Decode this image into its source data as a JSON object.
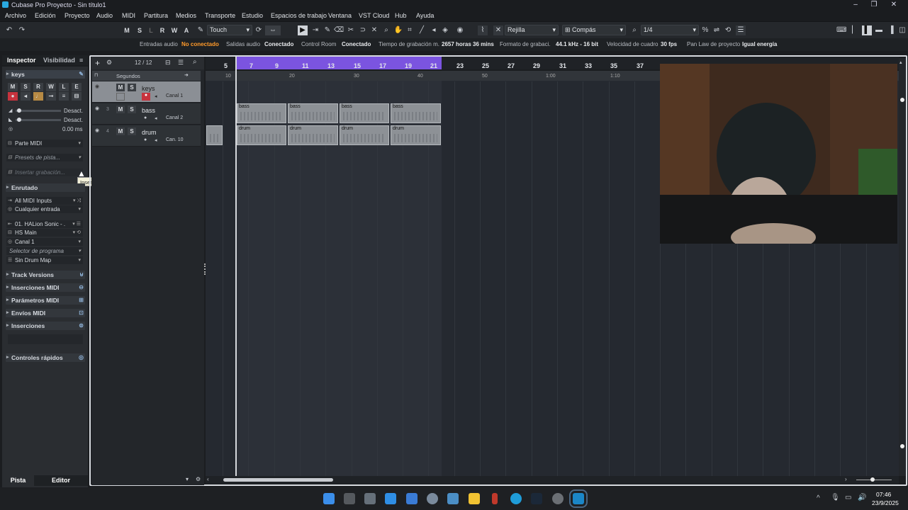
{
  "window": {
    "title": "Cubase Pro Proyecto - Sin título1",
    "minimize": "–",
    "maximize": "❐",
    "close": "✕"
  },
  "menu": [
    "Archivo",
    "Edición",
    "Proyecto",
    "Audio",
    "MIDI",
    "Partitura",
    "Medios",
    "Transporte",
    "Estudio",
    "Espacios de trabajo",
    "Ventana",
    "VST Cloud",
    "Hub",
    "Ayuda"
  ],
  "toolbar": {
    "msrwl": [
      "M",
      "S",
      "L",
      "R",
      "W",
      "A"
    ],
    "automation_mode": "Touch",
    "snap_type": "Rejilla",
    "grid_type": "Compás",
    "quantize": "1/4"
  },
  "status": {
    "entradas_audio_label": "Entradas audio",
    "entradas_audio_value": "No conectado",
    "salidas_audio_label": "Salidas audio",
    "salidas_audio_value": "Conectado",
    "control_room_label": "Control Room",
    "control_room_value": "Conectado",
    "rec_time_label": "Tiempo de grabación m.",
    "rec_time_value": "2657 horas 36 mins",
    "rec_format_label": "Formato de grabaci.",
    "rec_format_value": "44.1 kHz - 16 bit",
    "frame_rate_label": "Velocidad de cuadro",
    "frame_rate_value": "30 fps",
    "pan_law_label": "Pan Law de proyecto",
    "pan_law_value": "Igual energía"
  },
  "inspector": {
    "tab_inspector": "Inspector",
    "tab_visibility": "Visibilidad",
    "track_name": "keys",
    "btns": [
      "M",
      "S",
      "R",
      "W",
      "L",
      "E"
    ],
    "vol_label": "Desact.",
    "pan_label": "Desact.",
    "delay_value": "0.00 ms",
    "midi_part": "Parte MIDI",
    "presets": "Presets de pista...",
    "insert_rec": "Insertar grabación...",
    "tooltip": "Insertar grabación retrospectiva",
    "routing": "Enrutado",
    "input": "All MIDI Inputs",
    "input_sub": "Cualquier entrada",
    "output": "01. HALion Sonic - .",
    "output_sub": "HS Main",
    "channel": "Canal 1",
    "program": "Selector de programa",
    "drum_map": "Sin Drum Map",
    "sections": [
      "Track Versions",
      "Inserciones MIDI",
      "Parámetros MIDI",
      "Envíos MIDI",
      "Inserciones"
    ],
    "quick": "Controles rápidos",
    "bottom_tab_track": "Pista",
    "bottom_tab_editor": "Editor"
  },
  "tracklist": {
    "count": "12 / 12",
    "seconds": "Segundos",
    "tracks": [
      {
        "num": "2",
        "name": "keys",
        "channel": "Canal 1"
      },
      {
        "num": "3",
        "name": "bass",
        "channel": "Canal 2"
      },
      {
        "num": "4",
        "name": "drum",
        "channel": "Can. 10"
      }
    ]
  },
  "ruler": {
    "bars": [
      "5",
      "7",
      "9",
      "11",
      "13",
      "15",
      "17",
      "19",
      "21",
      "23",
      "25",
      "27",
      "29",
      "31",
      "33",
      "35",
      "37"
    ],
    "seconds": [
      "10",
      "20",
      "30",
      "40",
      "50",
      "1:00",
      "1:10"
    ]
  },
  "clips": {
    "bass": "bass",
    "drum": "drum"
  },
  "taskbar": {
    "time": "07:46",
    "date": "23/9/2025"
  }
}
